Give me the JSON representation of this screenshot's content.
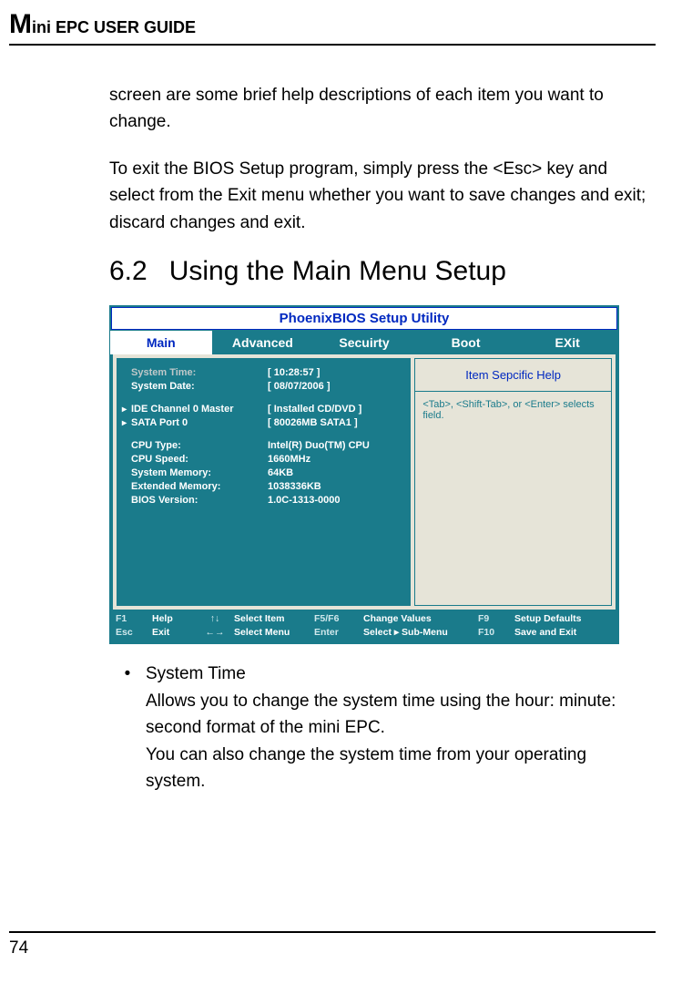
{
  "header": {
    "title_big": "M",
    "title_rest": "ini EPC USER GUIDE"
  },
  "paragraphs": {
    "p1": "screen are some brief help descriptions of each item you want to change.",
    "p2": "To exit the BIOS Setup program, simply press the <Esc> key and select from the Exit menu whether you want to save changes and exit; discard changes and exit."
  },
  "section": {
    "number": "6.2",
    "title": "Using the Main Menu Setup"
  },
  "bios": {
    "title": "PhoenixBIOS Setup Utility",
    "tabs": [
      "Main",
      "Advanced",
      "Secuirty",
      "Boot",
      "EXit"
    ],
    "active_tab": 0,
    "rows": [
      {
        "arrow": "",
        "label": "System Time:",
        "val": "[  10:28:57  ]",
        "selected": true
      },
      {
        "arrow": "",
        "label": "System Date:",
        "val": "[  08/07/2006  ]"
      }
    ],
    "rows2": [
      {
        "arrow": "▸",
        "label": "IDE Channel 0 Master",
        "val": "[  Installed CD/DVD  ]"
      },
      {
        "arrow": "▸",
        "label": "SATA Port 0",
        "val": "[  80026MB SATA1  ]"
      }
    ],
    "rows3": [
      {
        "arrow": "",
        "label": "CPU Type:",
        "val": "Intel(R) Duo(TM) CPU"
      },
      {
        "arrow": "",
        "label": "CPU Speed:",
        "val": "1660MHz"
      },
      {
        "arrow": "",
        "label": "System Memory:",
        "val": "64KB"
      },
      {
        "arrow": "",
        "label": "Extended Memory:",
        "val": "1038336KB"
      },
      {
        "arrow": "",
        "label": "BIOS Version:",
        "val": "1.0C-1313-0000"
      }
    ],
    "help_title": "Item Sepcific Help",
    "help_body": "<Tab>, <Shift-Tab>, or <Enter> selects field.",
    "footer": {
      "c1a": "F1",
      "c1b": "Esc",
      "c2a": "Help",
      "c2b": "Exit",
      "c3a": "↑↓",
      "c3b": "←→",
      "c4a": "Select Item",
      "c4b": "Select Menu",
      "c5a": "F5/F6",
      "c5b": "Enter",
      "c6a": "Change Values",
      "c6b": "Select ▸ Sub-Menu",
      "c7a": "F9",
      "c7b": "F10",
      "c8a": "Setup  Defaults",
      "c8b": "Save and Exit"
    }
  },
  "bullet": {
    "title": "System Time",
    "line1": "Allows you to change the system time using the hour: minute: second format of the mini EPC.",
    "line2": "You can also change the system time from your operating system."
  },
  "page_number": "74"
}
